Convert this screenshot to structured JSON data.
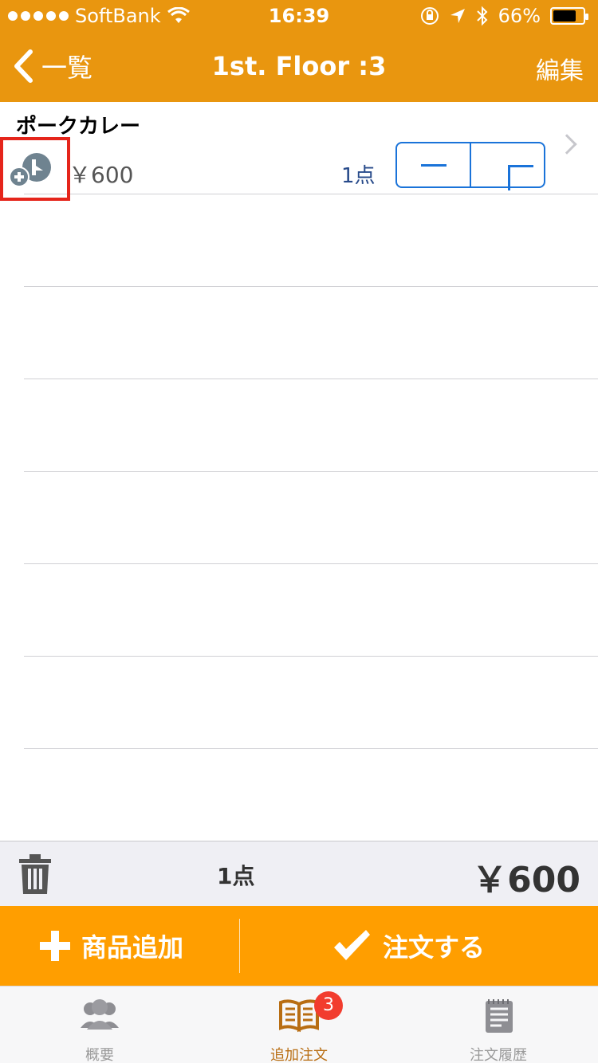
{
  "status": {
    "carrier": "SoftBank",
    "time": "16:39",
    "battery": "66%"
  },
  "nav": {
    "back_label": "一覧",
    "title": "1st. Floor :3",
    "edit_label": "編集"
  },
  "order_items": [
    {
      "name": "ポークカレー",
      "price": "￥600",
      "quantity": "1点"
    }
  ],
  "summary": {
    "count": "1点",
    "total": "￥600"
  },
  "actions": {
    "add_label": "商品追加",
    "order_label": "注文する"
  },
  "tabs": [
    {
      "label": "概要",
      "icon": "people-icon",
      "active": false
    },
    {
      "label": "追加注文",
      "icon": "book-icon",
      "active": true
    },
    {
      "label": "注文履歴",
      "icon": "notepad-icon",
      "active": false,
      "badge": "3"
    }
  ],
  "colors": {
    "nav": "#E9960F",
    "action": "#FF9E00",
    "stepper": "#1a73d9",
    "badge": "#f23c2e"
  }
}
